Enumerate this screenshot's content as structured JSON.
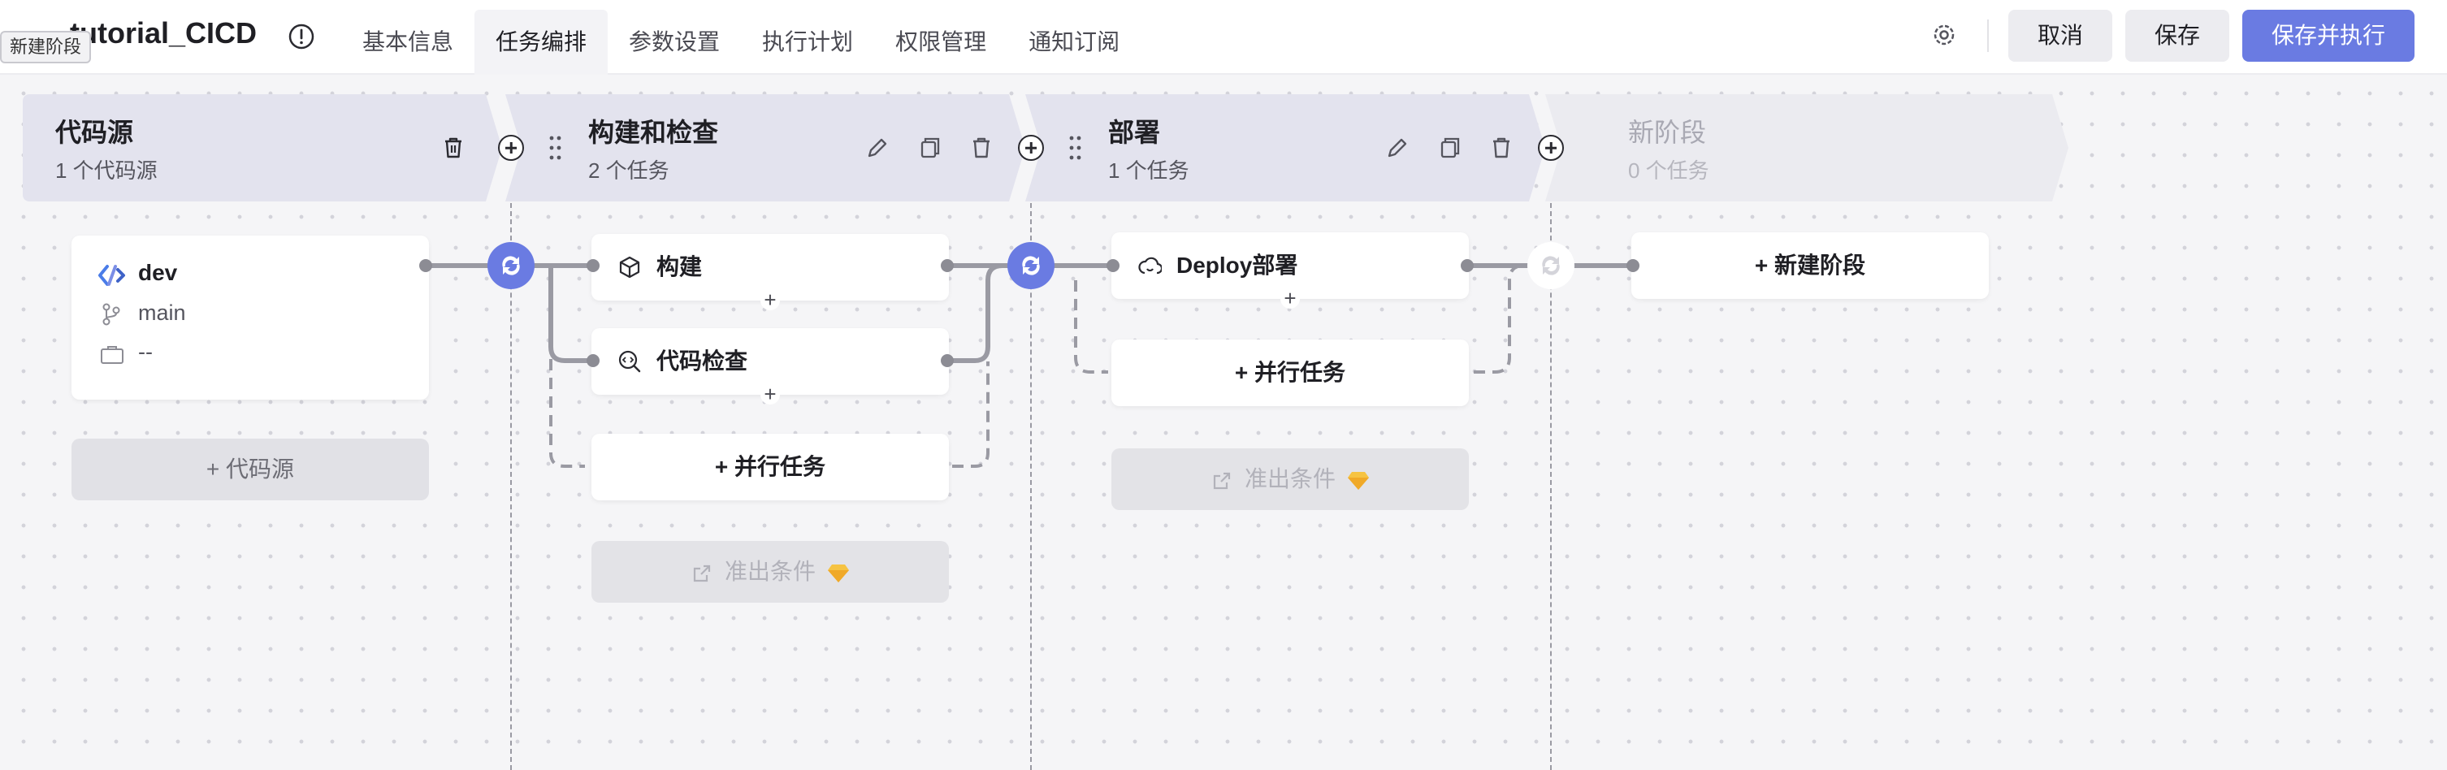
{
  "tooltip": "新建阶段",
  "header": {
    "title": "tutorial_CICD",
    "tabs": [
      {
        "label": "基本信息",
        "active": false
      },
      {
        "label": "任务编排",
        "active": true
      },
      {
        "label": "参数设置",
        "active": false
      },
      {
        "label": "执行计划",
        "active": false
      },
      {
        "label": "权限管理",
        "active": false
      },
      {
        "label": "通知订阅",
        "active": false
      }
    ],
    "buttons": {
      "cancel": "取消",
      "save": "保存",
      "save_run": "保存并执行"
    }
  },
  "stages": [
    {
      "name": "代码源",
      "sub": "1 个代码源"
    },
    {
      "name": "构建和检查",
      "sub": "2 个任务"
    },
    {
      "name": "部署",
      "sub": "1 个任务"
    },
    {
      "name": "新阶段",
      "sub": "0 个任务"
    }
  ],
  "source": {
    "name": "dev",
    "branch": "main",
    "commit": "--",
    "add_label": "+ 代码源"
  },
  "tasks": {
    "build": "构建",
    "check": "代码检查",
    "deploy": "Deploy部署",
    "parallel_1": "+ 并行任务",
    "parallel_2": "+ 并行任务",
    "exit_cond_1": "准出条件",
    "exit_cond_2": "准出条件",
    "new_stage": "+ 新建阶段"
  },
  "colors": {
    "accent": "#6a7be2",
    "stage_bg": "#e3e3ee",
    "canvas": "#f5f5f7"
  }
}
